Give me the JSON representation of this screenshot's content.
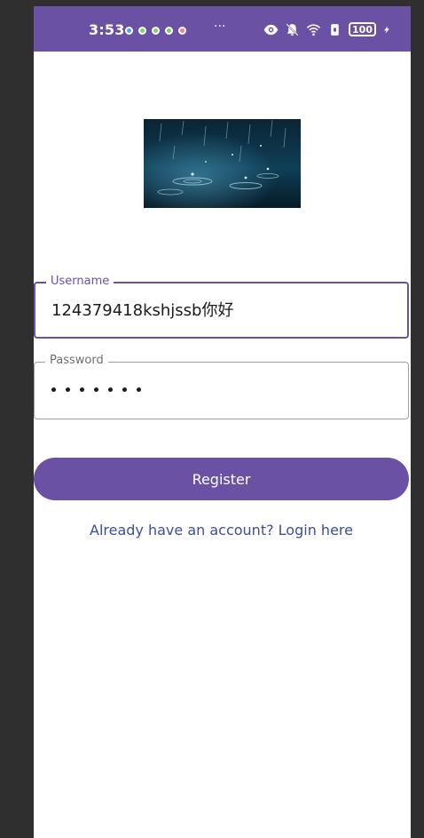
{
  "status_bar": {
    "time": "3:53",
    "more": "···",
    "battery": "100",
    "bg_color": "#6a51a3"
  },
  "form": {
    "username_label": "Username",
    "username_value": "124379418kshjssb你好",
    "password_label": "Password",
    "password_masked_length": 7
  },
  "actions": {
    "register_label": "Register",
    "login_link": "Already have an account? Login here"
  },
  "colors": {
    "primary": "#6a51a3",
    "link": "#3d4d9d",
    "frame": "#2f2f2f"
  },
  "icons": {
    "eye": "eye-icon",
    "mute": "bell-off-icon",
    "wifi": "wifi-icon",
    "sim": "sim-icon",
    "charge": "charging-bolt-icon"
  }
}
